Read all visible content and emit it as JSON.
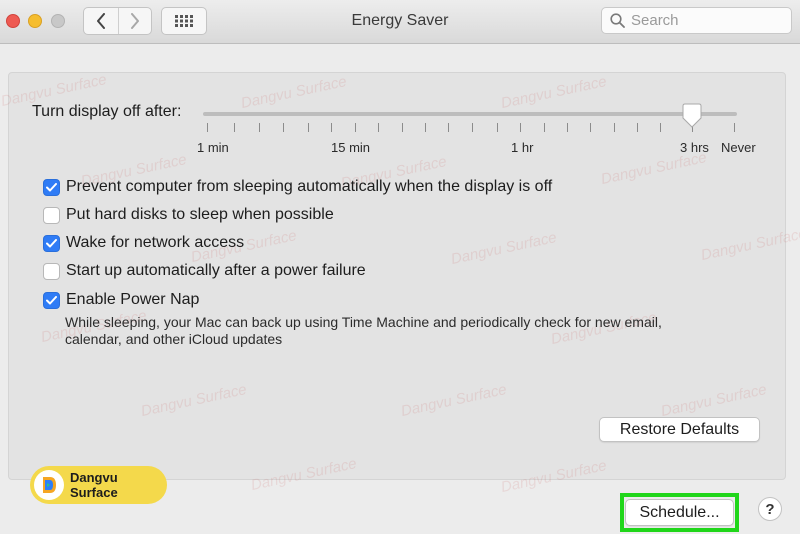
{
  "window": {
    "title": "Energy Saver",
    "search_placeholder": "Search",
    "buttons": {
      "back_icon": "chevron-left-icon",
      "forward_icon": "chevron-right-icon",
      "show_all_icon": "grid-icon"
    }
  },
  "display_sleep": {
    "label": "Turn display off after:",
    "tick_labels": [
      "1 min",
      "15 min",
      "1 hr",
      "3 hrs",
      "Never"
    ],
    "selected": "3 hrs"
  },
  "options": [
    {
      "label": "Prevent computer from sleeping automatically when the display is off",
      "checked": true
    },
    {
      "label": "Put hard disks to sleep when possible",
      "checked": false
    },
    {
      "label": "Wake for network access",
      "checked": true
    },
    {
      "label": "Start up automatically after a power failure",
      "checked": false
    },
    {
      "label": "Enable Power Nap",
      "checked": true
    }
  ],
  "power_nap_description": "While sleeping, your Mac can back up using Time Machine and periodically check for new email, calendar, and other iCloud updates",
  "buttons": {
    "restore_defaults": "Restore Defaults",
    "schedule": "Schedule...",
    "help": "?"
  },
  "watermark": {
    "text": "Dangvu Surface",
    "badge_text": "Dangvu Surface"
  },
  "colors": {
    "checkbox_on": "#2f7cf6",
    "highlight": "#20d61a",
    "badge": "#f4d94b"
  }
}
